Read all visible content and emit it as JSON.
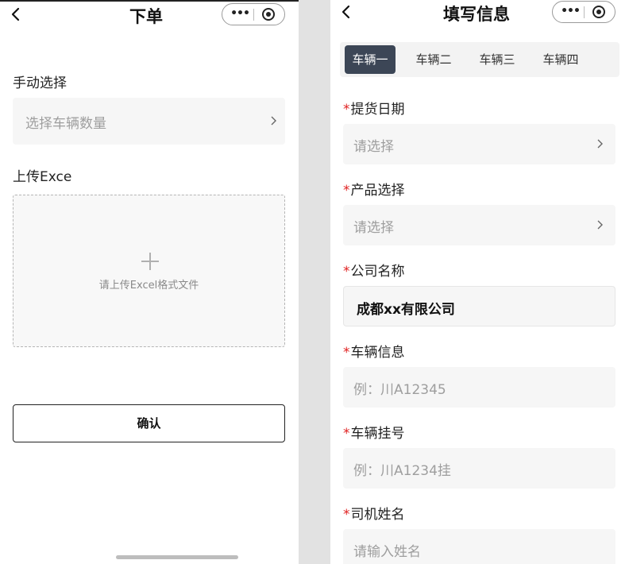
{
  "left": {
    "title": "下单",
    "manual": {
      "label": "手动选择",
      "placeholder": "选择车辆数量"
    },
    "upload": {
      "label": "上传Exce",
      "hint": "请上传Excel格式文件"
    },
    "confirm_label": "确认"
  },
  "right": {
    "title": "填写信息",
    "tabs": [
      {
        "label": "车辆一",
        "active": true
      },
      {
        "label": "车辆二",
        "active": false
      },
      {
        "label": "车辆三",
        "active": false
      },
      {
        "label": "车辆四",
        "active": false
      }
    ],
    "required_mark": "*",
    "fields": [
      {
        "label": "提货日期",
        "placeholder": "请选择",
        "type": "select"
      },
      {
        "label": "产品选择",
        "placeholder": "请选择",
        "type": "select"
      },
      {
        "label": "公司名称",
        "value": "成都xx有限公司",
        "type": "text"
      },
      {
        "label": "车辆信息",
        "placeholder": "例：川A12345",
        "type": "text"
      },
      {
        "label": "车辆挂号",
        "placeholder": "例：川A1234挂",
        "type": "text"
      },
      {
        "label": "司机姓名",
        "placeholder": "请输入姓名",
        "type": "text"
      }
    ]
  },
  "capsule_icons": {
    "more": "more-dots-icon",
    "close": "target-circle-icon"
  },
  "colors": {
    "active_tab_bg": "#3c4656",
    "required": "#e02020",
    "placeholder": "#9e9e9e",
    "field_bg": "#f6f6f6"
  }
}
